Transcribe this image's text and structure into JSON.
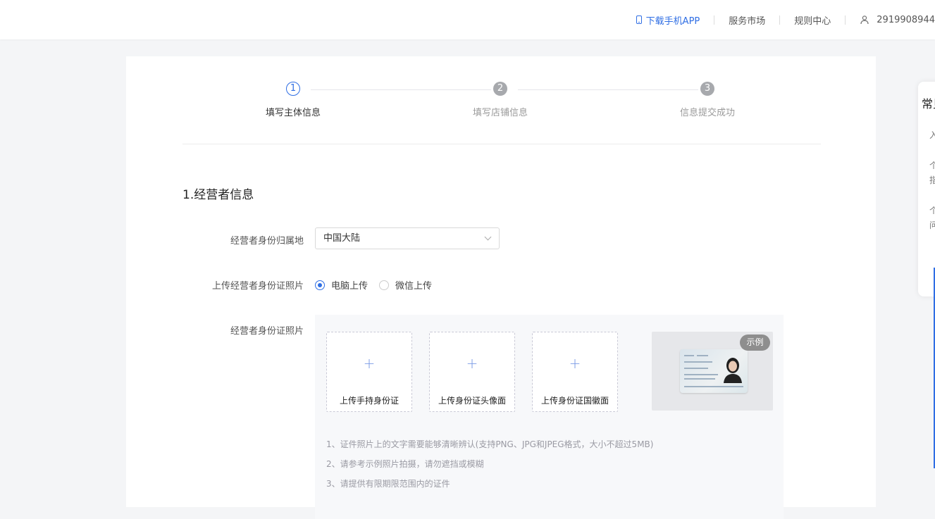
{
  "header": {
    "download_app": "下载手机APP",
    "service_market": "服务市场",
    "rules_center": "规则中心",
    "user_id": "2919908944"
  },
  "steps": [
    {
      "num": "1",
      "label": "填写主体信息"
    },
    {
      "num": "2",
      "label": "填写店铺信息"
    },
    {
      "num": "3",
      "label": "信息提交成功"
    }
  ],
  "section": {
    "title": "1.经营者信息"
  },
  "form": {
    "region_label": "经营者身份归属地",
    "region_value": "中国大陆",
    "upload_method_label": "上传经营者身份证照片",
    "upload_methods": [
      "电脑上传",
      "微信上传"
    ],
    "id_photo_label": "经营者身份证照片",
    "upload_boxes": [
      {
        "plus": "+",
        "caption": "上传手持身份证"
      },
      {
        "plus": "+",
        "caption": "上传身份证头像面"
      },
      {
        "plus": "+",
        "caption": "上传身份证国徽面"
      }
    ],
    "example_tag": "示例",
    "notes": [
      "1、证件照片上的文字需要能够清晰辨认(支持PNG、JPG和JPEG格式，大小不超过5MB)",
      "2、请参考示例照片拍摄，请勿遮挡或模糊",
      "3、请提供有限期限范围内的证件"
    ]
  },
  "side_panel": {
    "title": "常见",
    "items": [
      "入",
      "个",
      "指",
      "个",
      "问"
    ]
  },
  "colors": {
    "accent": "#2f6ee4",
    "inactive_step": "#a7a9ad"
  }
}
